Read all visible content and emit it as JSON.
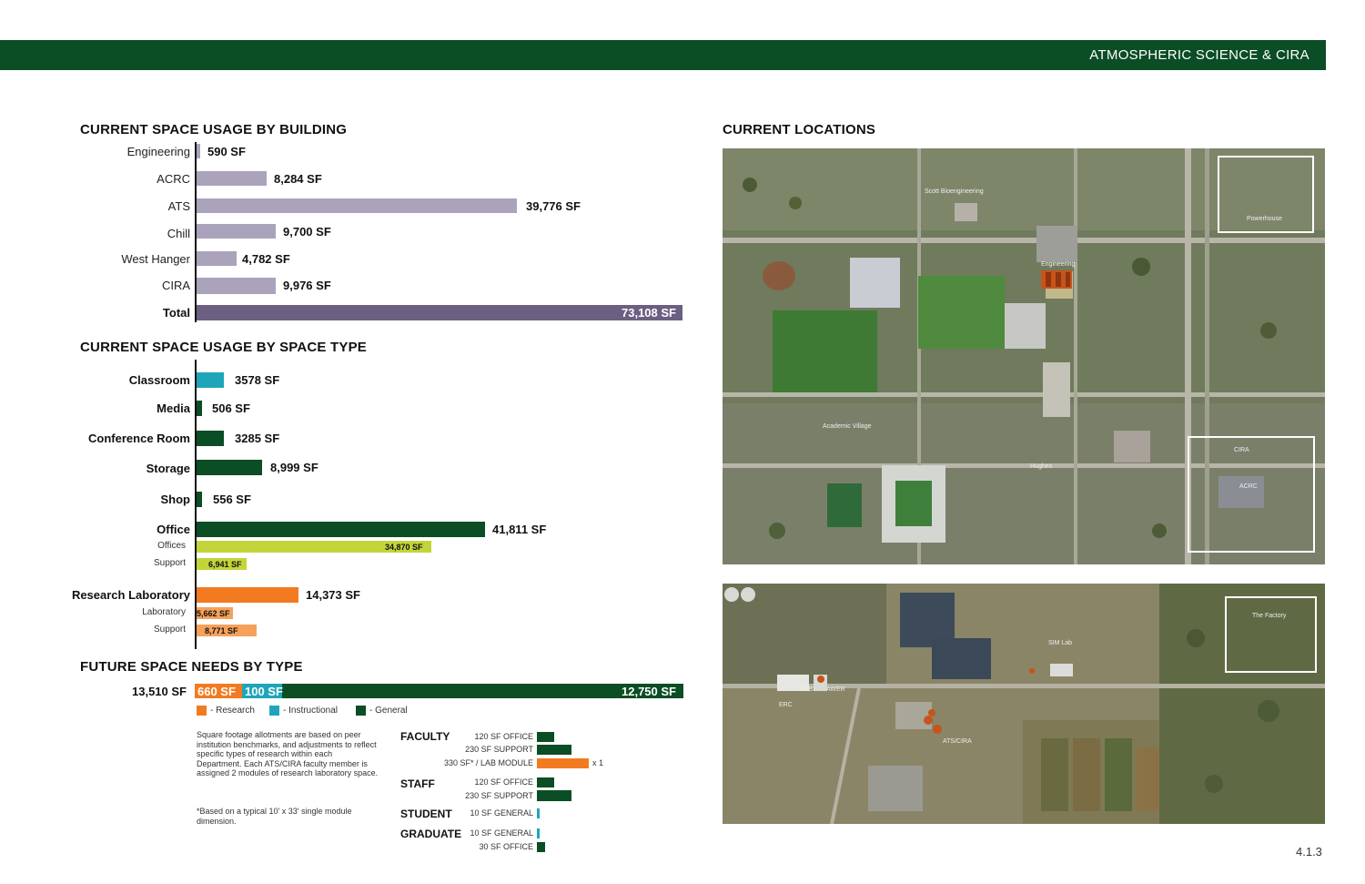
{
  "header": {
    "title": "ATMOSPHERIC SCIENCE & CIRA"
  },
  "building_usage": {
    "title": "CURRENT SPACE USAGE BY BUILDING",
    "rows": [
      {
        "label": "Engineering",
        "value": "590 SF",
        "sf": 590
      },
      {
        "label": "ACRC",
        "value": "8,284 SF",
        "sf": 8284
      },
      {
        "label": "ATS",
        "value": "39,776 SF",
        "sf": 39776
      },
      {
        "label": "Chill",
        "value": "9,700 SF",
        "sf": 9700
      },
      {
        "label": "West Hanger",
        "value": "4,782 SF",
        "sf": 4782
      },
      {
        "label": "CIRA",
        "value": "9,976 SF",
        "sf": 9976
      }
    ],
    "total": {
      "label": "Total",
      "value": "73,108 SF",
      "sf": 73108
    }
  },
  "space_type_usage": {
    "title": "CURRENT SPACE USAGE BY SPACE TYPE",
    "rows": [
      {
        "label": "Classroom",
        "value": "3578 SF",
        "sf": 3578
      },
      {
        "label": "Media",
        "value": "506 SF",
        "sf": 506
      },
      {
        "label": "Conference Room",
        "value": "3285 SF",
        "sf": 3285
      },
      {
        "label": "Storage",
        "value": "8,999 SF",
        "sf": 8999
      },
      {
        "label": "Shop",
        "value": "556 SF",
        "sf": 556
      },
      {
        "label": "Office",
        "value": "41,811 SF",
        "sf": 41811
      },
      {
        "label": "Offices",
        "value": "34,870 SF",
        "sf": 34870
      },
      {
        "label": "Support",
        "value": "6,941 SF",
        "sf": 6941
      },
      {
        "label": "Research Laboratory",
        "value": "14,373 SF",
        "sf": 14373
      },
      {
        "label": "Laboratory",
        "value": "5,662 SF",
        "sf": 5662
      },
      {
        "label": "Support",
        "value": "8,771 SF",
        "sf": 8771
      }
    ]
  },
  "future_needs": {
    "title": "FUTURE SPACE NEEDS BY TYPE",
    "total": "13,510 SF",
    "segments": [
      {
        "label": "660 SF",
        "sf": 660
      },
      {
        "label": "100 SF",
        "sf": 100
      },
      {
        "label": "12,750 SF",
        "sf": 12750
      }
    ],
    "legend": [
      "- Research",
      "- Instructional",
      "- General"
    ],
    "note": "Square footage allotments are based on peer institution benchmarks, and adjustments to reflect specific types of research within each Department. Each ATS/CIRA faculty member is assigned 2 modules of research laboratory space.",
    "footnote": "*Based on a typical 10' x 33' single module dimension.",
    "allotments": {
      "faculty": {
        "label": "FACULTY",
        "rows": [
          "120 SF OFFICE",
          "230 SF SUPPORT",
          "330 SF* / LAB MODULE"
        ],
        "multiplier": "x 1"
      },
      "staff": {
        "label": "STAFF",
        "rows": [
          "120 SF OFFICE",
          "230 SF SUPPORT"
        ]
      },
      "student": {
        "label": "STUDENT",
        "rows": [
          "10 SF GENERAL"
        ]
      },
      "graduate": {
        "label": "GRADUATE",
        "rows": [
          "10 SF GENERAL",
          "30 SF OFFICE"
        ]
      }
    }
  },
  "locations": {
    "title": "CURRENT LOCATIONS",
    "map1_labels": [
      "Scott Bioengineering",
      "Engineering",
      "Academic Village",
      "Powerhouse",
      "CIRA",
      "ACRC",
      "Hughes"
    ],
    "map2_labels": [
      "SIM Lab",
      "LABI",
      "AWER",
      "ERC",
      "ATS/CIRA",
      "The Factory"
    ]
  },
  "colors": {
    "banner": "#0b4d24",
    "building_bar": "#aba3bb",
    "total_bar": "#6b5f82",
    "teal": "#1fa5ba",
    "green": "#0b4d24",
    "lime": "#c3d43a",
    "orange": "#f27b21",
    "light_orange": "#f6a15a"
  },
  "page_number": "4.1.3"
}
